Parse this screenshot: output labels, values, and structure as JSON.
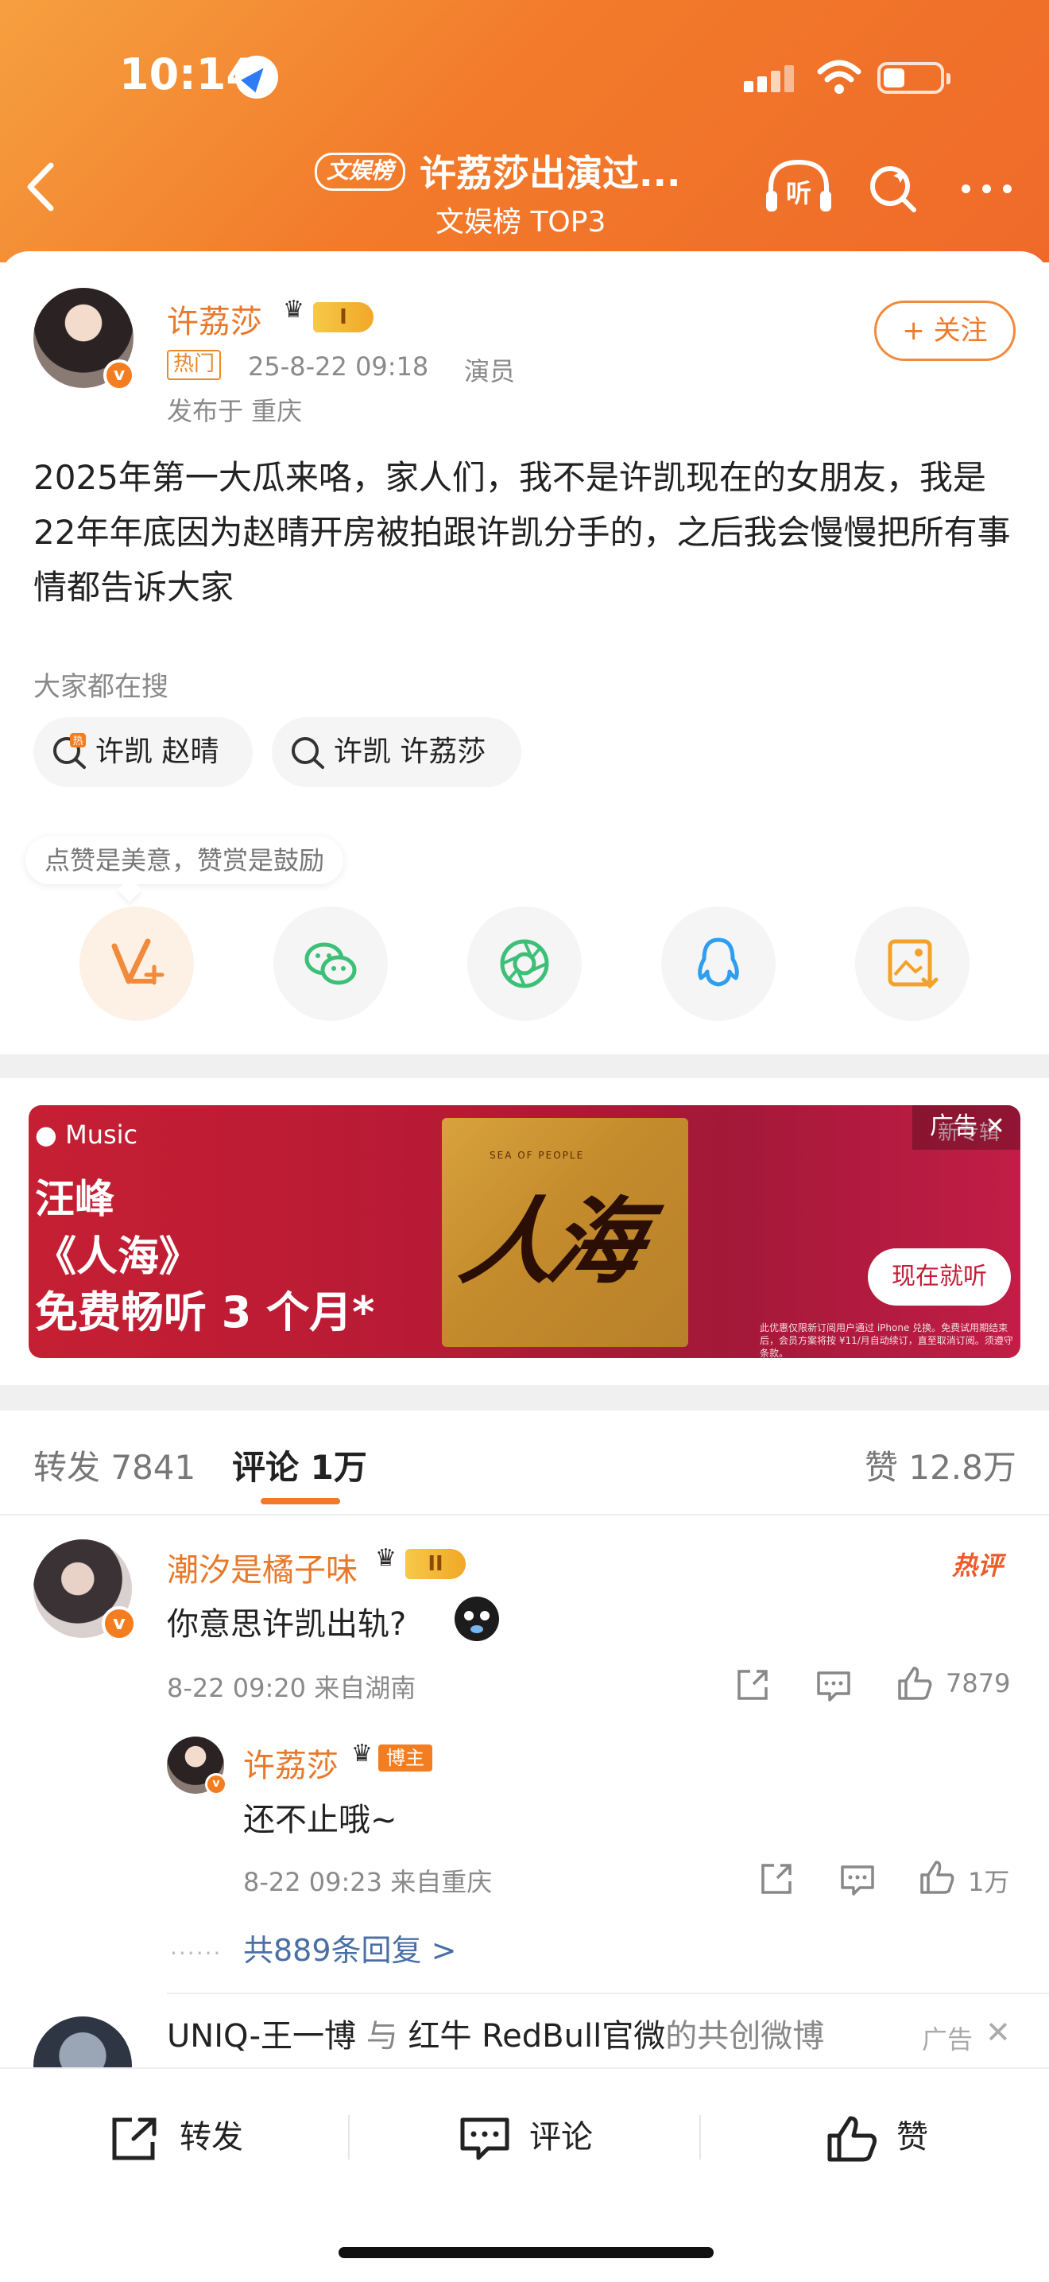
{
  "status_bar": {
    "time": "10:14"
  },
  "header": {
    "badge": "文娱榜",
    "title": "许荔莎出演过...",
    "subtitle": "文娱榜 TOP3"
  },
  "post": {
    "author": "许荔莎",
    "level": "I",
    "hot_tag": "热门",
    "time": "25-8-22 09:18",
    "role": "演员",
    "location": "发布于 重庆",
    "follow_label": "+ 关注",
    "text": "2025年第一大瓜来咯，家人们，我不是许凯现在的女朋友，我是22年年底因为赵晴开房被拍跟许凯分手的，之后我会慢慢把所有事情都告诉大家",
    "search_label": "大家都在搜",
    "search_chips": [
      "许凯 赵晴",
      "许凯 许荔莎"
    ],
    "tip": "点赞是美意，赞赏是鼓励"
  },
  "ad": {
    "brand": "Music",
    "lines": [
      "汪峰",
      "《人海》",
      "免费畅听 3 个月*"
    ],
    "album_text": "人海",
    "album_small": "SEA OF PEOPLE",
    "tag": "广告",
    "corner_label": "新专辑",
    "cta": "现在就听",
    "fine_print": "此优惠仅限新订阅用户通过 iPhone 兑换。免费试用期结束后，会员方案将按 ¥11/月自动续订，直至取消订阅。须遵守条款。"
  },
  "tabs": {
    "repost": "转发 7841",
    "comments": "评论 1万",
    "likes": "赞 12.8万"
  },
  "comments": [
    {
      "user": "潮汐是橘子味",
      "level": "II",
      "hot_label": "热评",
      "text": "你意思许凯出轨?",
      "meta": "8-22 09:20  来自湖南",
      "likes": "7879",
      "reply": {
        "user": "许荔莎",
        "badge": "博主",
        "text": "还不止哦~",
        "meta": "8-22 09:23  来自重庆",
        "likes": "1万"
      },
      "more_replies": "共889条回复 >"
    }
  ],
  "cocreate": {
    "user1": "UNIQ-王一博",
    "connector": "与",
    "user2": "红牛 RedBull官微",
    "suffix": "的共创微博",
    "ad_label": "广告"
  },
  "bottom_bar": {
    "repost": "转发",
    "comment": "评论",
    "like": "赞"
  },
  "colors": {
    "accent": "#ee7a2a",
    "header_gradient_start": "#f6a040",
    "header_gradient_end": "#ef6a2a",
    "ad_red": "#c51f33"
  }
}
